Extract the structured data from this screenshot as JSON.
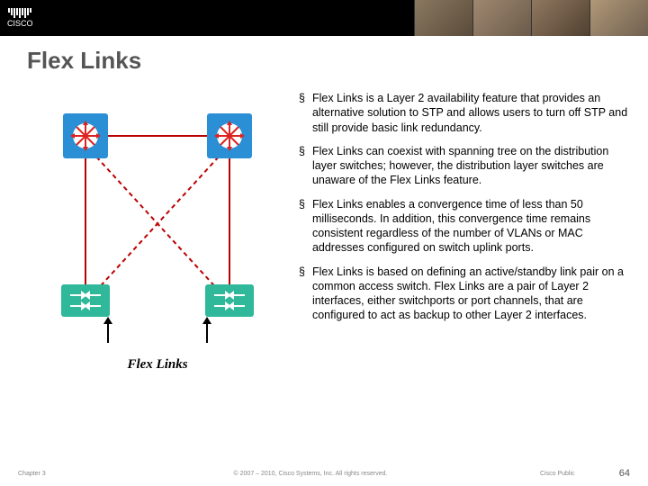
{
  "logo_text": "CISCO",
  "title": "Flex Links",
  "bullets": [
    "Flex Links is a Layer 2 availability feature that provides an alternative solution to STP and allows users to turn off STP and still provide basic link redundancy.",
    "Flex Links can coexist with spanning tree on the distribution layer switches; however, the distribution layer switches are unaware of the Flex Links feature.",
    "Flex Links enables a convergence time of less than 50 milliseconds. In addition, this convergence time remains consistent regardless of the number of VLANs or MAC addresses configured on switch uplink ports.",
    "Flex Links is based on defining an active/standby link pair on a common access switch. Flex Links are a pair of Layer 2 interfaces, either switchports or port channels, that are configured to act as backup to other Layer 2 interfaces."
  ],
  "diagram_caption": "Flex Links",
  "footer": {
    "chapter": "Chapter 3",
    "copyright": "© 2007 – 2010, Cisco Systems, Inc. All rights reserved.",
    "public": "Cisco Public",
    "page": "64"
  }
}
